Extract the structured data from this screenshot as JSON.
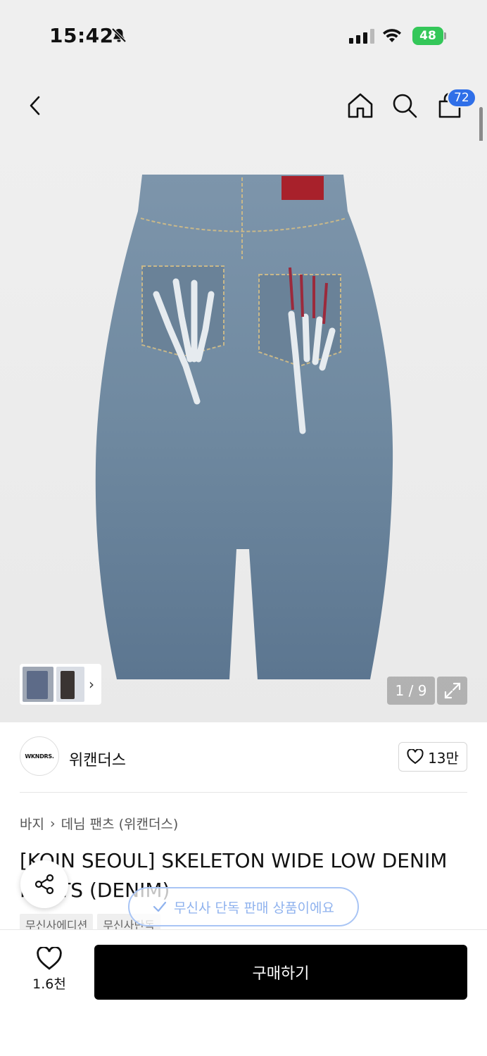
{
  "status": {
    "time": "15:42",
    "battery": "48"
  },
  "nav": {
    "cart_count": "72"
  },
  "gallery": {
    "counter": "1 / 9"
  },
  "brand": {
    "logo_text": "WKNDRS.",
    "name": "위캔더스",
    "likes": "13만"
  },
  "breadcrumb": {
    "category": "바지",
    "subcategory": "데님 팬츠 (위캔더스)"
  },
  "product": {
    "title": "[KOIN SEOUL] SKELETON WIDE LOW DENIM PANTS (DENIM)",
    "tags": [
      "무신사에디션",
      "무신사단독"
    ]
  },
  "toast": {
    "text": "무신사 단독 판매 상품이에요"
  },
  "bottom": {
    "wish_count": "1.6천",
    "buy_label": "구매하기"
  },
  "colors": {
    "badge": "#2f6fe8",
    "battery": "#34c759",
    "buy_button": "#000000",
    "toast_text": "#8fb2ee"
  },
  "icons": [
    "back-icon",
    "home-icon",
    "search-icon",
    "shopping-bag-icon",
    "expand-icon",
    "heart-icon",
    "share-icon",
    "check-icon",
    "bell-slash-icon",
    "wifi-icon"
  ]
}
